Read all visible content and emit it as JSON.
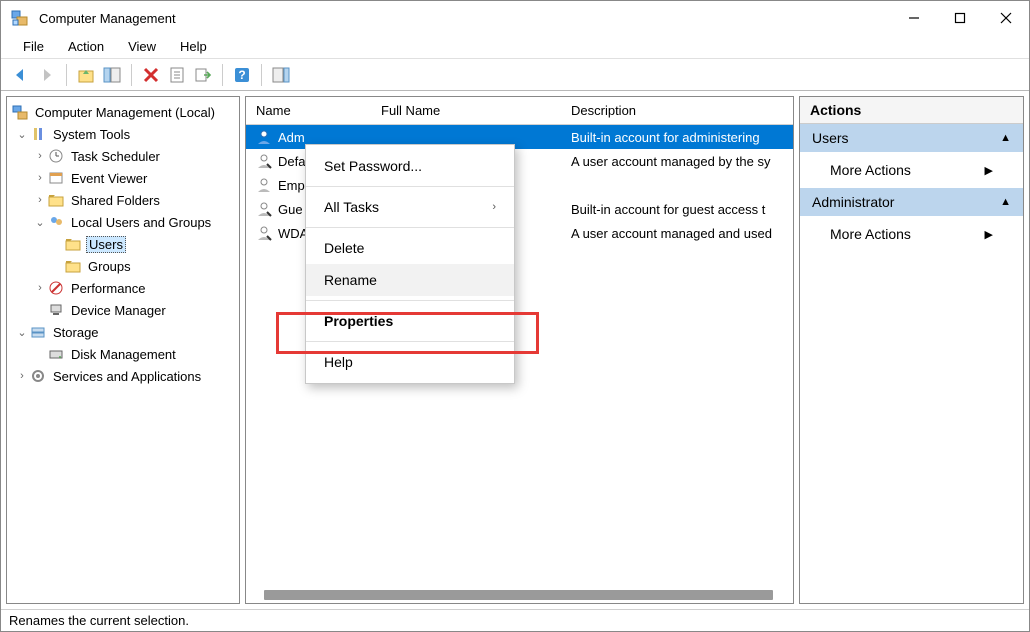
{
  "window": {
    "title": "Computer Management"
  },
  "menubar": {
    "file": "File",
    "action": "Action",
    "view": "View",
    "help": "Help"
  },
  "tree": {
    "root": "Computer Management (Local)",
    "system_tools": "System Tools",
    "task_scheduler": "Task Scheduler",
    "event_viewer": "Event Viewer",
    "shared_folders": "Shared Folders",
    "local_users": "Local Users and Groups",
    "users": "Users",
    "groups": "Groups",
    "performance": "Performance",
    "device_manager": "Device Manager",
    "storage": "Storage",
    "disk_mgmt": "Disk Management",
    "services_apps": "Services and Applications"
  },
  "list": {
    "headers": {
      "name": "Name",
      "full_name": "Full Name",
      "description": "Description"
    },
    "rows": [
      {
        "name": "Adm",
        "full": "",
        "desc": "Built-in account for administering"
      },
      {
        "name": "Defa",
        "full": "",
        "desc": "A user account managed by the sy"
      },
      {
        "name": "Emp",
        "full": "",
        "desc": ""
      },
      {
        "name": "Gue",
        "full": "",
        "desc": "Built-in account for guest access t"
      },
      {
        "name": "WDA",
        "full": "",
        "desc": "A user account managed and used"
      }
    ]
  },
  "ctx": {
    "set_password": "Set Password...",
    "all_tasks": "All Tasks",
    "delete": "Delete",
    "rename": "Rename",
    "properties": "Properties",
    "help": "Help"
  },
  "actions": {
    "title": "Actions",
    "sec1": "Users",
    "more1": "More Actions",
    "sec2": "Administrator",
    "more2": "More Actions"
  },
  "status": "Renames the current selection."
}
